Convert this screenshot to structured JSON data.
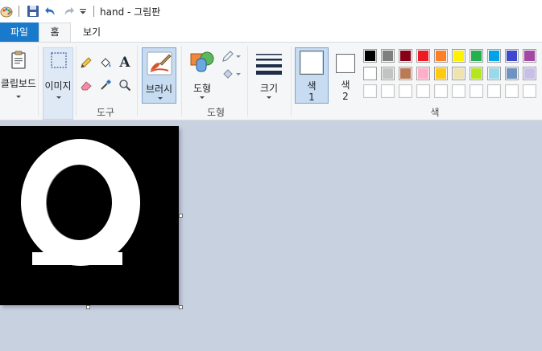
{
  "title": "hand - 그림판",
  "tabs": {
    "file": "파일",
    "home": "홈",
    "view": "보기"
  },
  "ribbon": {
    "clipboard": "클립보드",
    "image": "이미지",
    "tools": "도구",
    "brushes": "브러시",
    "shapes_button": "도형",
    "shapes_group": "도형",
    "size": "크기",
    "color1_line1": "색",
    "color1_line2": "1",
    "color2_line1": "색",
    "color2_line2": "2",
    "colors_group": "색"
  },
  "palette": [
    [
      "#000000",
      "#7f7f7f",
      "#880015",
      "#ed1c24",
      "#ff7f27",
      "#fff200",
      "#22b14c",
      "#00a2e8",
      "#3f48cc",
      "#a349a4"
    ],
    [
      "#ffffff",
      "#c3c3c3",
      "#b97a57",
      "#ffaec9",
      "#ffc90e",
      "#efe4b0",
      "#b5e61d",
      "#99d9ea",
      "#7092be",
      "#c8bfe7"
    ],
    [
      "#ffffff",
      "#ffffff",
      "#ffffff",
      "#ffffff",
      "#ffffff",
      "#ffffff",
      "#ffffff",
      "#ffffff",
      "#ffffff",
      "#ffffff"
    ]
  ],
  "colors": {
    "accent": "#1979ca",
    "color1": "#ffffff",
    "color2": "#ffffff",
    "canvas_bg": "#000000",
    "stroke": "#ffffff",
    "workspace": "#c8d1e0"
  }
}
